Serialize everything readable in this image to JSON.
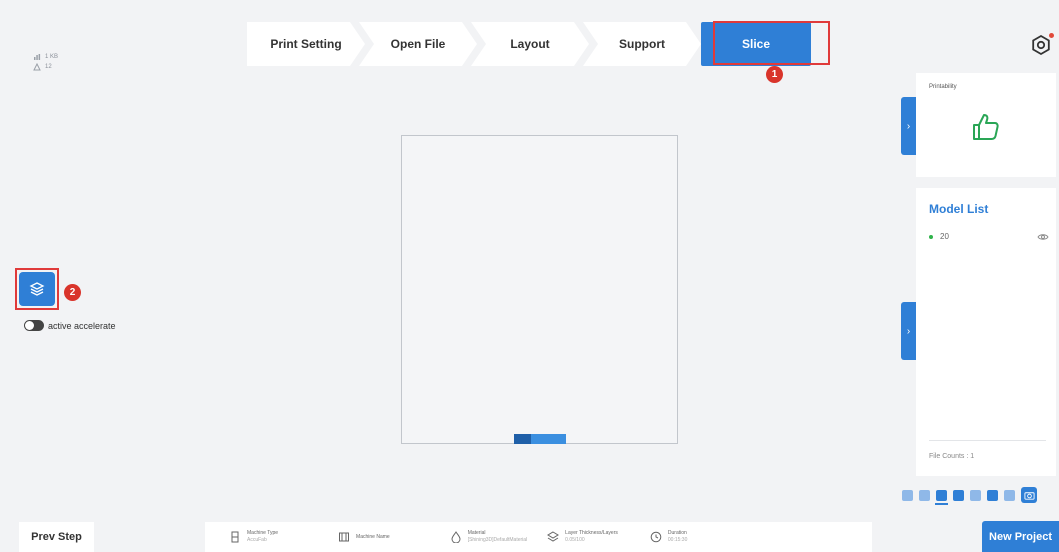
{
  "stats": {
    "size": "1 KB",
    "triangles": "12"
  },
  "steps": [
    {
      "label": "Print Setting"
    },
    {
      "label": "Open File"
    },
    {
      "label": "Layout"
    },
    {
      "label": "Support"
    },
    {
      "label": "Slice"
    }
  ],
  "annotations": {
    "badge1": "1",
    "badge2": "2"
  },
  "left_tools": {
    "accelerate_label": "active accelerate"
  },
  "printability": {
    "title": "Printability"
  },
  "model_list": {
    "title": "Model List",
    "items": [
      {
        "name": "20"
      }
    ],
    "file_counts": "File Counts : 1"
  },
  "bottom": {
    "prev_label": "Prev Step",
    "new_project_label": "New Project",
    "info": {
      "machine_type": {
        "label": "Machine Type",
        "value": "AccuFab"
      },
      "machine_name": {
        "label": "Machine Name",
        "value": ""
      },
      "material": {
        "label": "Material",
        "value": "[Shining3D]DefaultMaterial"
      },
      "layer": {
        "label": "Layer Thickness/Layers",
        "value": "0.05/100"
      },
      "duration": {
        "label": "Duration",
        "value": "00:15:30"
      }
    }
  },
  "colors": {
    "accent": "#2f7fd6",
    "highlight": "#e03a3a",
    "badge": "#d9342b",
    "status_ok": "#2fb34a"
  }
}
